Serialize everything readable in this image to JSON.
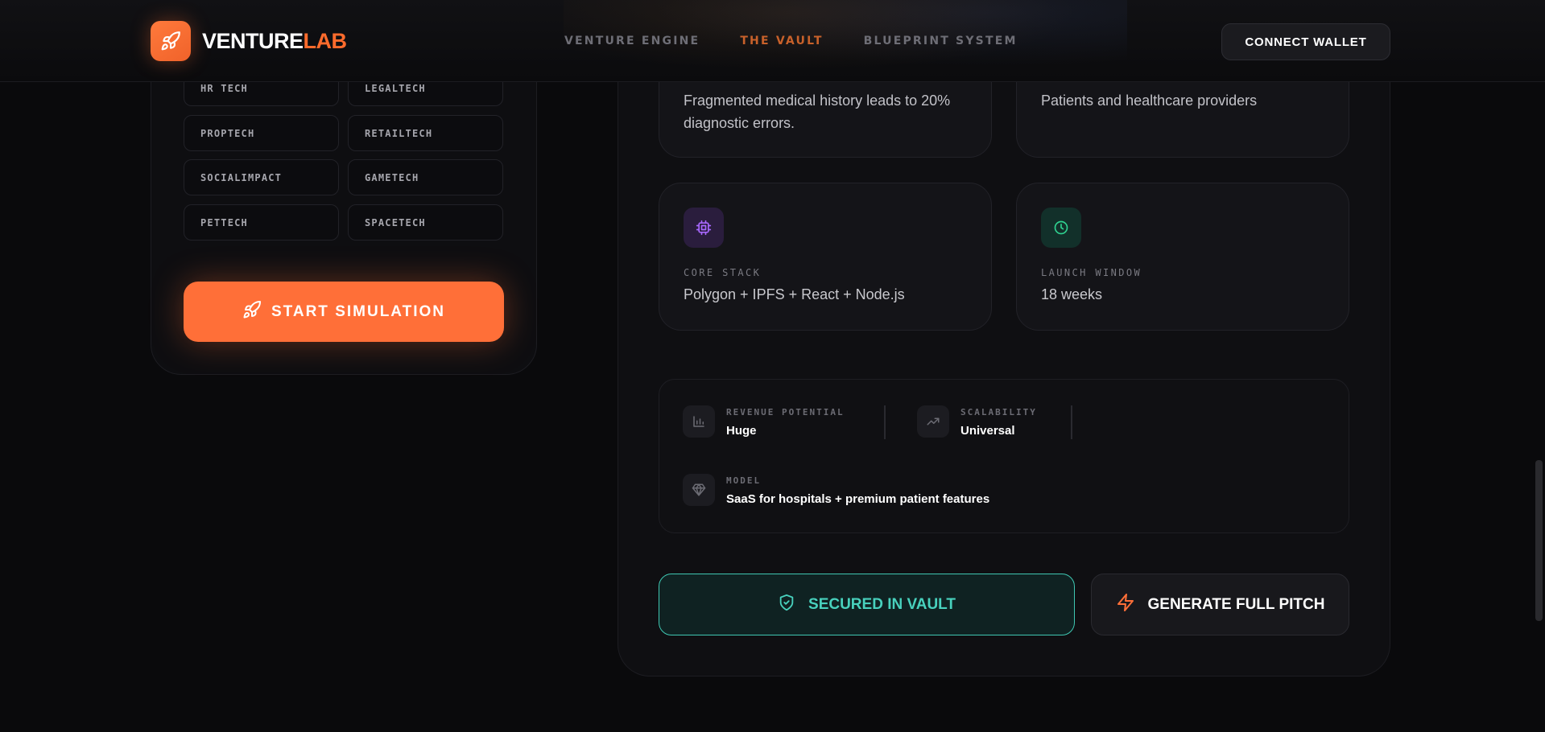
{
  "header": {
    "logo_primary": "VENTURE",
    "logo_accent": "LAB",
    "nav": [
      {
        "label": "VENTURE ENGINE",
        "active": false
      },
      {
        "label": "THE VAULT",
        "active": true
      },
      {
        "label": "BLUEPRINT SYSTEM",
        "active": false
      }
    ],
    "wallet_button": "CONNECT WALLET"
  },
  "sectors": [
    "HR TECH",
    "LEGALTECH",
    "PROPTECH",
    "RETAILTECH",
    "SOCIALIMPACT",
    "GAMETECH",
    "PETTECH",
    "SPACETECH"
  ],
  "start_button": "START SIMULATION",
  "cards": {
    "problem_text": "Fragmented medical history leads to 20% diagnostic errors.",
    "audience_text": "Patients and healthcare providers",
    "core_stack": {
      "label": "CORE STACK",
      "value": "Polygon + IPFS + React + Node.js",
      "icon": "cpu-icon",
      "color": "#a868ff"
    },
    "launch_window": {
      "label": "LAUNCH WINDOW",
      "value": "18 weeks",
      "icon": "clock-icon",
      "color": "#2fd08f"
    }
  },
  "metrics": {
    "revenue": {
      "label": "REVENUE POTENTIAL",
      "value": "Huge",
      "icon": "bar-chart-icon"
    },
    "scalability": {
      "label": "SCALABILITY",
      "value": "Universal",
      "icon": "trending-up-icon"
    },
    "model": {
      "label": "MODEL",
      "value": "SaaS for hospitals + premium patient features",
      "icon": "diamond-icon"
    }
  },
  "actions": {
    "vault_button": "SECURED IN VAULT",
    "pitch_button": "GENERATE FULL PITCH"
  },
  "colors": {
    "accent": "#ff6f38",
    "vault": "#48d1bd",
    "background": "#0a0a0c"
  }
}
